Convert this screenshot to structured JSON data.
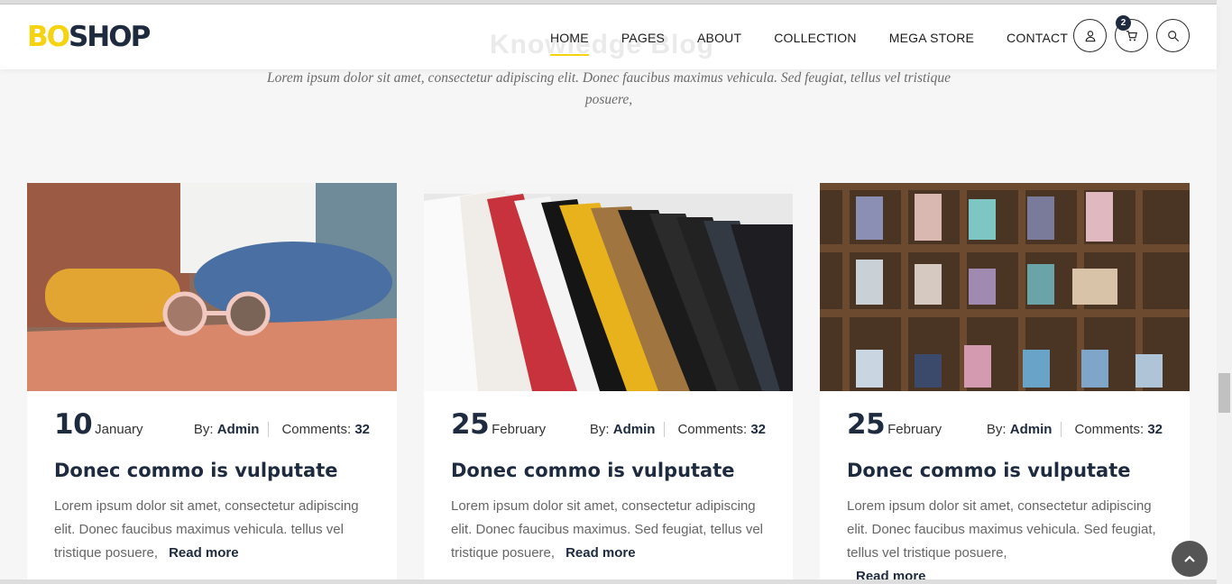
{
  "brand": {
    "logo_part1": "BO",
    "logo_part2": "SHOP"
  },
  "nav": {
    "items": [
      "HOME",
      "PAGES",
      "ABOUT",
      "COLLECTION",
      "MEGA STORE",
      "CONTACT"
    ],
    "active": "HOME"
  },
  "header": {
    "cart_count": "2",
    "section_title": "Knowledge Blog"
  },
  "intro": "Lorem ipsum dolor sit amet, consectetur adipiscing elit. Donec faucibus maximus vehicula. Sed feugiat, tellus vel tristique posuere,",
  "posts": [
    {
      "day": "10",
      "month": "January",
      "by_label": "By:",
      "author": "Admin",
      "comments_label": "Comments:",
      "comments": "32",
      "title": "Donec commo is vulputate",
      "excerpt": "Lorem ipsum dolor sit amet, consectetur adipiscing elit. Donec faucibus maximus vehicula. tellus vel tristique posuere,",
      "read_more": "Read more"
    },
    {
      "day": "25",
      "month": "February",
      "by_label": "By:",
      "author": "Admin",
      "comments_label": "Comments:",
      "comments": "32",
      "title": "Donec commo is vulputate",
      "excerpt": "Lorem ipsum dolor sit amet, consectetur adipiscing elit. Donec faucibus maximus. Sed feugiat, tellus vel tristique posuere,",
      "read_more": "Read more"
    },
    {
      "day": "25",
      "month": "February",
      "by_label": "By:",
      "author": "Admin",
      "comments_label": "Comments:",
      "comments": "32",
      "title": "Donec commo is vulputate",
      "excerpt": "Lorem ipsum dolor sit amet, consectetur adipiscing elit. Donec faucibus maximus vehicula. Sed feugiat, tellus vel tristique posuere,",
      "read_more": "Read more"
    }
  ],
  "colors": {
    "accent": "#f5d310",
    "navy": "#1e2a3d"
  },
  "icons": {
    "user": "user-icon",
    "cart": "cart-icon",
    "search": "search-icon",
    "back_to_top": "chevron-up-icon"
  }
}
